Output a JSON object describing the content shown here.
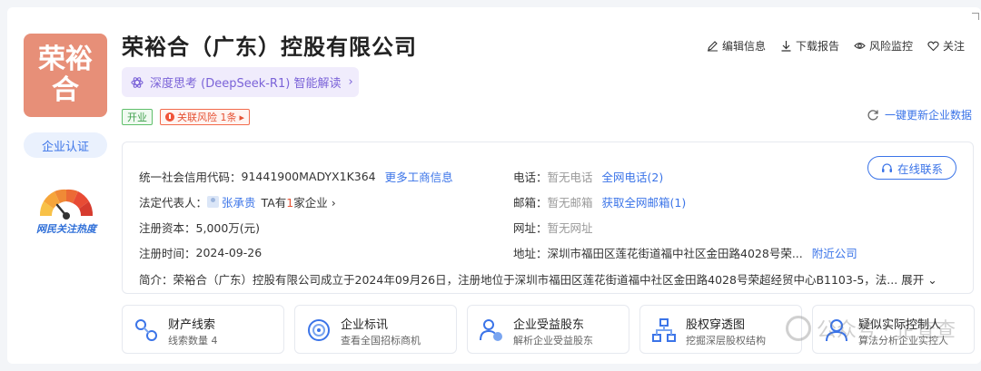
{
  "company": {
    "logo_text": "荣裕合",
    "name": "荣裕合（广东）控股有限公司",
    "certification": "企业认证",
    "heat_label": "网民关注热度"
  },
  "deepseek": {
    "label": "深度思考 (DeepSeek-R1) 智能解读"
  },
  "tags": {
    "status": "开业",
    "risk": "关联风险 1条"
  },
  "actions": {
    "edit": "编辑信息",
    "download": "下载报告",
    "monitor": "风险监控",
    "follow": "关注"
  },
  "refresh": "一键更新企业数据",
  "info": {
    "credit_code_label": "统一社会信用代码：",
    "credit_code": "91441900MADYX1K364",
    "more_business": "更多工商信息",
    "legal_rep_label": "法定代表人：",
    "legal_rep": "张承贵",
    "legal_rep_companies_pre": "TA有",
    "legal_rep_companies_num": "1",
    "legal_rep_companies_post": "家企业",
    "capital_label": "注册资本：",
    "capital": "5,000万(元)",
    "reg_time_label": "注册时间：",
    "reg_time": "2024-09-26",
    "phone_label": "电话：",
    "phone": "暂无电话",
    "phone_link": "全网电话(2)",
    "email_label": "邮箱：",
    "email": "暂无邮箱",
    "email_link": "获取全网邮箱(1)",
    "website_label": "网址：",
    "website": "暂无网址",
    "address_label": "地址：",
    "address": "深圳市福田区莲花街道福中社区金田路4028号荣...",
    "nearby": "附近公司",
    "intro_label": "简介：",
    "intro": "荣裕合（广东）控股有限公司成立于2024年09月26日，注册地位于深圳市福田区莲花街道福中社区金田路4028号荣超经贸中心B1103-5，法...",
    "expand": "展开",
    "contact_btn": "在线联系"
  },
  "bottom_cards": [
    {
      "title": "财产线索",
      "sub": "线索数量 4",
      "icon": "property-icon"
    },
    {
      "title": "企业标讯",
      "sub": "查看全国招标商机",
      "icon": "bidding-icon"
    },
    {
      "title": "企业受益股东",
      "sub": "解析企业受益股东",
      "icon": "shareholder-icon"
    },
    {
      "title": "股权穿透图",
      "sub": "挖掘深层股权结构",
      "icon": "equity-icon"
    },
    {
      "title": "疑似实际控制人",
      "sub": "算法分析企业实控人",
      "icon": "controller-icon"
    }
  ],
  "watermark": "公众号 · 企查查",
  "colors": {
    "accent": "#3b74e8",
    "logo_bg": "#e78f78",
    "risk": "#e55234",
    "open": "#3e9f4b"
  }
}
